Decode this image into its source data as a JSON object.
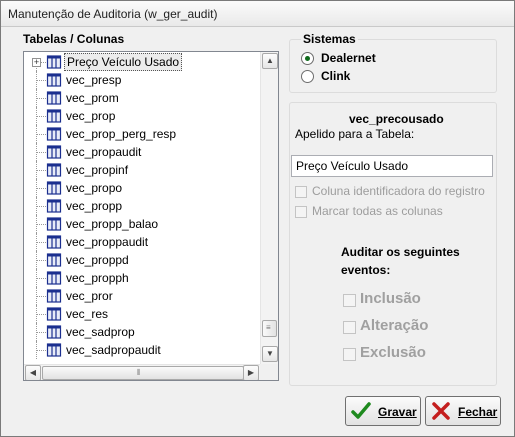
{
  "window": {
    "title": "Manutenção de Auditoria (w_ger_audit)"
  },
  "tables_group": {
    "label": "Tabelas / Colunas",
    "items": [
      {
        "label": "Preço Veículo Usado",
        "selected": true,
        "expandable": true
      },
      {
        "label": "vec_presp"
      },
      {
        "label": "vec_prom"
      },
      {
        "label": "vec_prop"
      },
      {
        "label": "vec_prop_perg_resp"
      },
      {
        "label": "vec_propaudit"
      },
      {
        "label": "vec_propinf"
      },
      {
        "label": "vec_propo"
      },
      {
        "label": "vec_propp"
      },
      {
        "label": "vec_propp_balao"
      },
      {
        "label": "vec_proppaudit"
      },
      {
        "label": "vec_proppd"
      },
      {
        "label": "vec_propph"
      },
      {
        "label": "vec_pror"
      },
      {
        "label": "vec_res"
      },
      {
        "label": "vec_sadprop"
      },
      {
        "label": "vec_sadpropaudit"
      }
    ],
    "icon": "database-table-icon"
  },
  "sistemas": {
    "label": "Sistemas",
    "options": [
      {
        "label": "Dealernet",
        "checked": true
      },
      {
        "label": "Clink",
        "checked": false
      }
    ]
  },
  "details": {
    "table_name": "vec_precousado",
    "alias_label": "Apelido para a Tabela:",
    "alias_value": "Preço Veículo Usado",
    "id_column_label": "Coluna identificadora do registro",
    "mark_all_label": "Marcar todas as colunas",
    "audit_label_line1": "Auditar os seguintes",
    "audit_label_line2": "eventos:",
    "events": [
      {
        "label": "Inclusão"
      },
      {
        "label": "Alteração"
      },
      {
        "label": "Exclusão"
      }
    ]
  },
  "buttons": {
    "save_label": "Gravar",
    "close_label": "Fechar"
  },
  "colors": {
    "check_green": "#1e8a1e",
    "close_red": "#c41e1e",
    "disabled_text": "#9d9d9d"
  }
}
